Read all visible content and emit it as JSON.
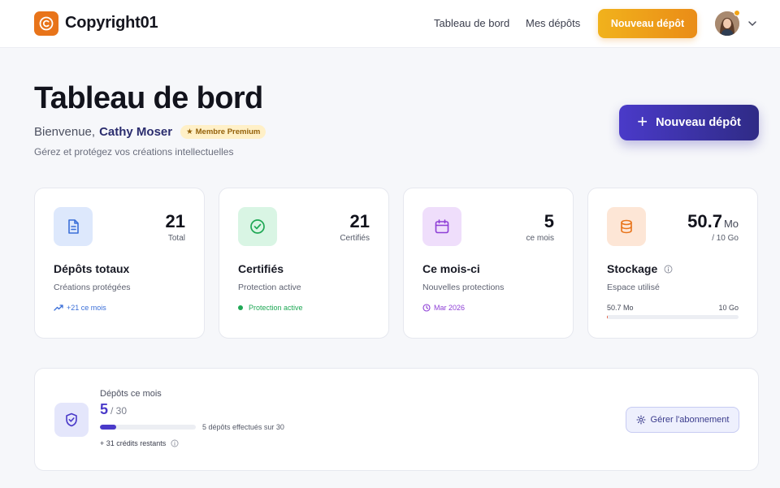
{
  "brand": {
    "name": "Copyright01"
  },
  "nav": {
    "links": [
      "Tableau de bord",
      "Mes dépôts"
    ],
    "cta_label": "Nouveau dépôt"
  },
  "header": {
    "title": "Tableau de bord",
    "welcome_prefix": "Bienvenue,",
    "user_name": "Cathy Moser",
    "badge": "Membre Premium",
    "subtitle": "Gérez et protégez vos créations intellectuelles",
    "cta_label": "Nouveau dépôt"
  },
  "cards": [
    {
      "value": "21",
      "value_label": "Total",
      "title": "Dépôts totaux",
      "subtitle": "Créations protégées",
      "footer": "+21 ce mois",
      "icon": "document-icon"
    },
    {
      "value": "21",
      "value_label": "Certifiés",
      "title": "Certifiés",
      "subtitle": "Protection active",
      "footer": "Protection active",
      "icon": "check-circle-icon"
    },
    {
      "value": "5",
      "value_label": "ce mois",
      "title": "Ce mois-ci",
      "subtitle": "Nouvelles protections",
      "footer": "Mar 2026",
      "icon": "calendar-icon"
    },
    {
      "value": "50.7",
      "unit": "Mo",
      "value_label": "/ 10 Go",
      "title": "Stockage",
      "subtitle": "Espace utilisé",
      "used_label": "50.7 Mo",
      "capacity_label": "10 Go",
      "usage_fraction": 0.005,
      "icon": "database-icon"
    }
  ],
  "subscription": {
    "label": "Dépôts ce mois",
    "count": "5",
    "total": "/ 30",
    "progress_fraction": 0.1667,
    "progress_text": "5 dépôts effectués sur 30",
    "credits": "+ 31 crédits restants",
    "manage_label": "Gérer l'abonnement"
  },
  "colors": {
    "brand_orange": "#e8741a",
    "primary_indigo": "#4a3ac9",
    "success_green": "#1fa855",
    "purple": "#8e3fd6",
    "storage_red": "#e45b3f"
  }
}
